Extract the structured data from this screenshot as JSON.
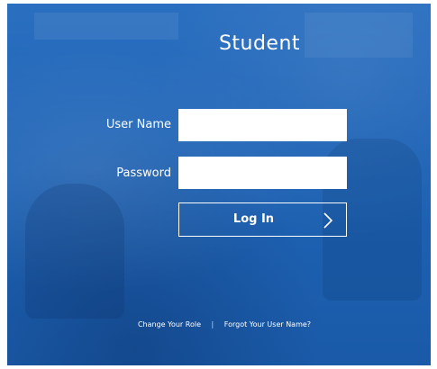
{
  "page": {
    "title": "Student"
  },
  "form": {
    "username_label": "User Name",
    "username_value": "",
    "password_label": "Password",
    "password_value": "",
    "login_label": "Log In"
  },
  "footer": {
    "change_role_label": "Change Your Role",
    "separator": "|",
    "forgot_username_label": "Forgot Your User Name?"
  },
  "colors": {
    "background": "#1a5fb4",
    "text": "#ffffff",
    "input_background": "#ffffff"
  },
  "icons": {
    "login_arrow": "chevron-right-icon"
  }
}
